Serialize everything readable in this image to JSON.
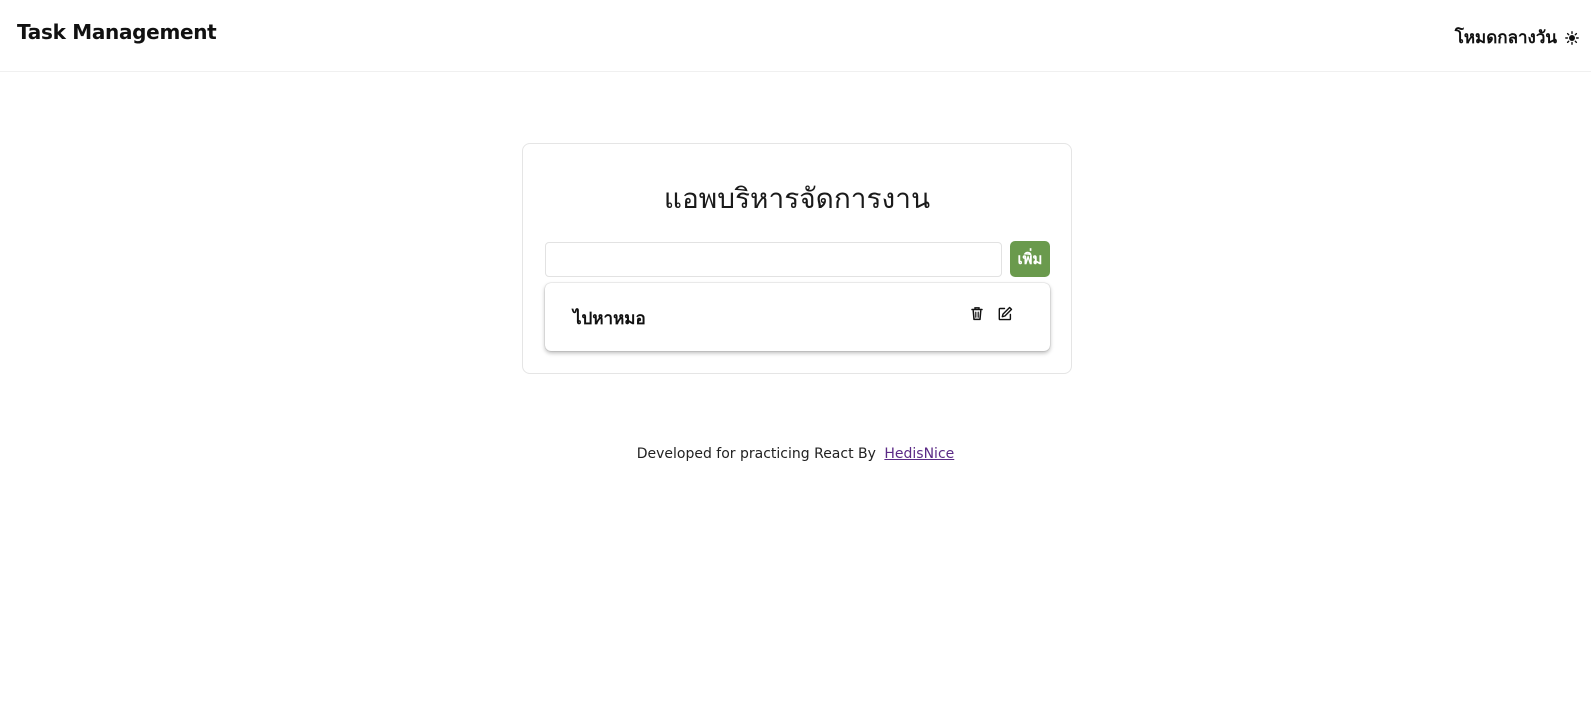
{
  "navbar": {
    "brand": "Task Management",
    "theme_label": "โหมดกลางวัน",
    "theme_icon": "sun-icon"
  },
  "card": {
    "title": "แอพบริหารจัดการงาน",
    "input": {
      "value": "",
      "placeholder": ""
    },
    "add_button_label": "เพิ่ม",
    "add_button_color": "#6a9a4d",
    "tasks": [
      {
        "text": "ไปหาหมอ",
        "delete_icon": "trash-icon",
        "edit_icon": "edit-icon"
      }
    ]
  },
  "footer": {
    "text": "Developed for practicing React By",
    "link_text": "HedisNice",
    "link_color": "#5b2a86"
  }
}
